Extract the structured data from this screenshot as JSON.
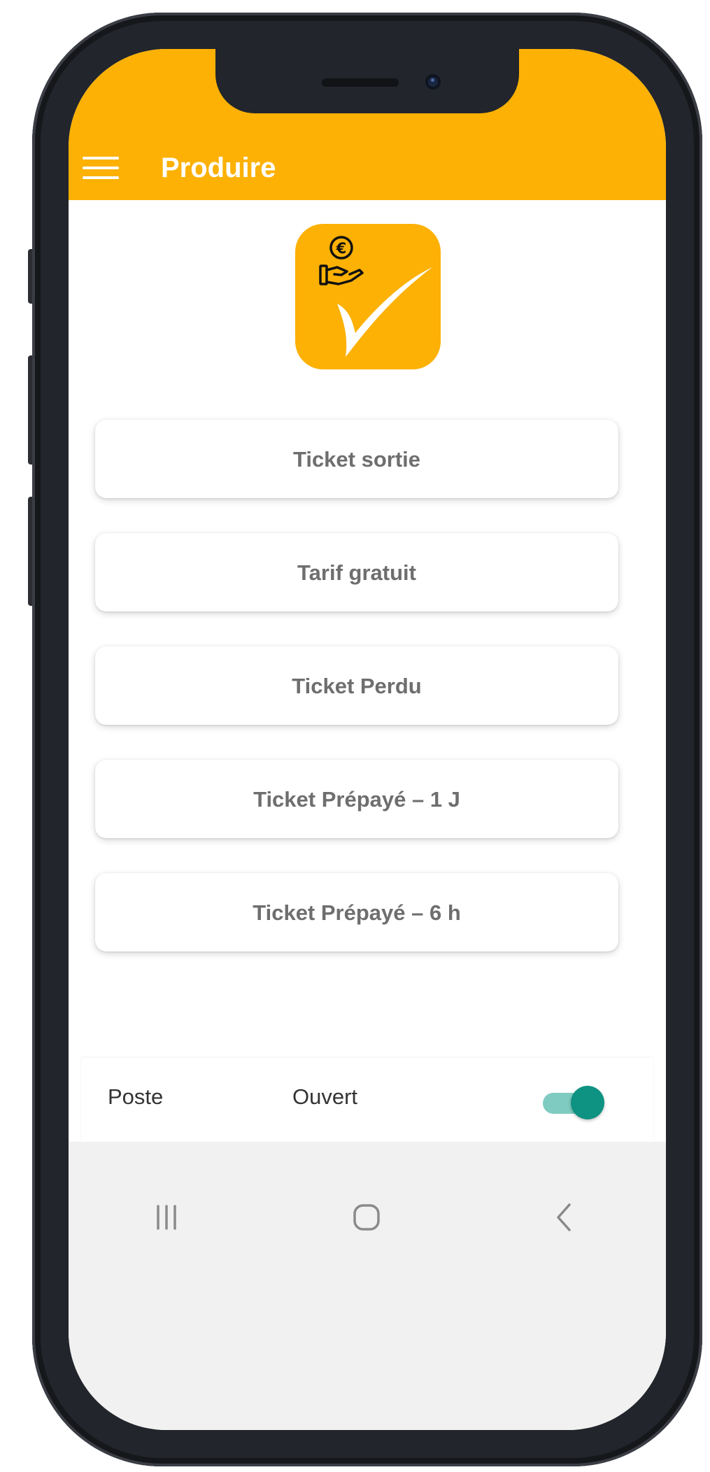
{
  "app_bar": {
    "title": "Produire",
    "background_color": "#fcb104",
    "menu_icon": "hamburger-menu-icon"
  },
  "logo": {
    "icon": "hand-euro-checkmark-icon",
    "background_color": "#fcb104"
  },
  "menu": {
    "items": [
      {
        "label": "Ticket sortie"
      },
      {
        "label": "Tarif gratuit"
      },
      {
        "label": "Ticket Perdu"
      },
      {
        "label": "Ticket Prépayé – 1 J"
      },
      {
        "label": "Ticket Prépayé – 6 h"
      }
    ]
  },
  "status": {
    "label": "Poste",
    "value": "Ouvert",
    "toggle_on": true,
    "toggle_color": "#0e9282"
  },
  "nav": {
    "recent_icon": "recent-apps-icon",
    "home_icon": "home-icon",
    "back_icon": "back-icon"
  }
}
